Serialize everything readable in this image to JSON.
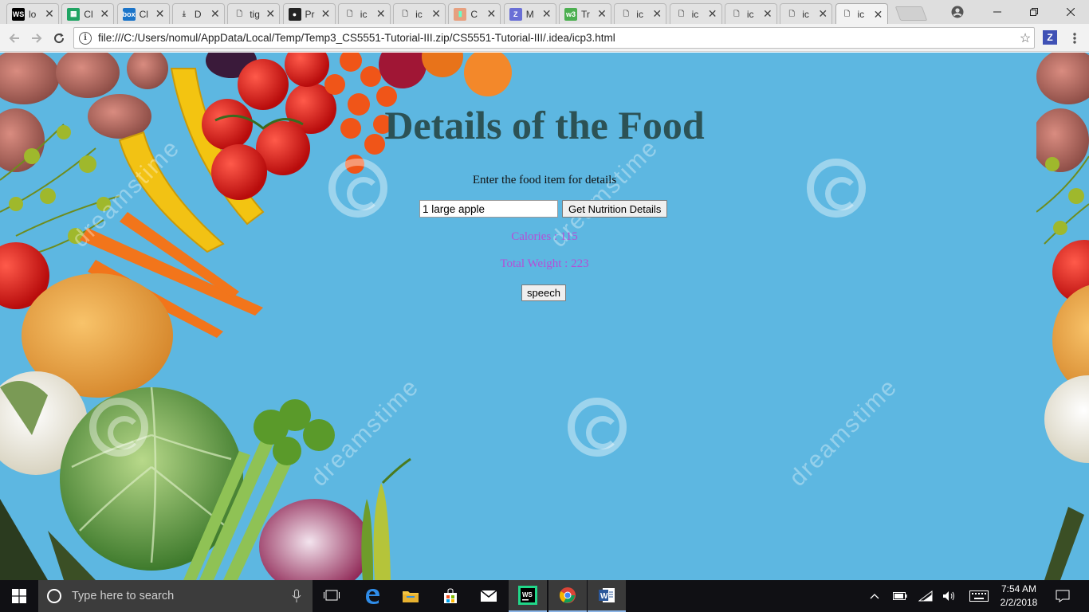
{
  "browser": {
    "tabs": [
      {
        "label": "lo",
        "icon": "webstorm-icon"
      },
      {
        "label": "Cl",
        "icon": "sheets-icon"
      },
      {
        "label": "Cl",
        "icon": "box-icon"
      },
      {
        "label": "D",
        "icon": "download-icon"
      },
      {
        "label": "tig",
        "icon": "page-icon"
      },
      {
        "label": "Pr",
        "icon": "github-icon"
      },
      {
        "label": "ic",
        "icon": "page-icon"
      },
      {
        "label": "ic",
        "icon": "page-icon"
      },
      {
        "label": "C",
        "icon": "colorful-icon"
      },
      {
        "label": "M",
        "icon": "zotero-icon"
      },
      {
        "label": "Tr",
        "icon": "w3-icon"
      },
      {
        "label": "ic",
        "icon": "page-icon"
      },
      {
        "label": "ic",
        "icon": "page-icon"
      },
      {
        "label": "ic",
        "icon": "page-icon"
      },
      {
        "label": "ic",
        "icon": "page-icon"
      },
      {
        "label": "ic",
        "icon": "page-icon"
      }
    ],
    "active_tab_index": 15,
    "url": "file:///C:/Users/nomul/AppData/Local/Temp/Temp3_CS5551-Tutorial-III.zip/CS5551-Tutorial-III/.idea/icp3.html",
    "extension_label": "Z"
  },
  "page": {
    "title": "Details of the Food",
    "prompt": "Enter the food item for details",
    "input_value": "1 large apple",
    "button_label": "Get Nutrition Details",
    "calories": "Calories : 115",
    "weight": "Total Weight : 223",
    "speech_label": "speech",
    "watermark": "dreamstime"
  },
  "taskbar": {
    "search_placeholder": "Type here to search",
    "time": "7:54 AM",
    "date": "2/2/2018",
    "pinned": [
      "task-view-icon",
      "edge-icon",
      "file-explorer-icon",
      "store-icon",
      "mail-icon",
      "webstorm-icon",
      "chrome-icon",
      "word-icon"
    ]
  },
  "colors": {
    "page_bg": "#5db7e1",
    "title": "#2c5255",
    "result_text": "#b44fd6"
  }
}
